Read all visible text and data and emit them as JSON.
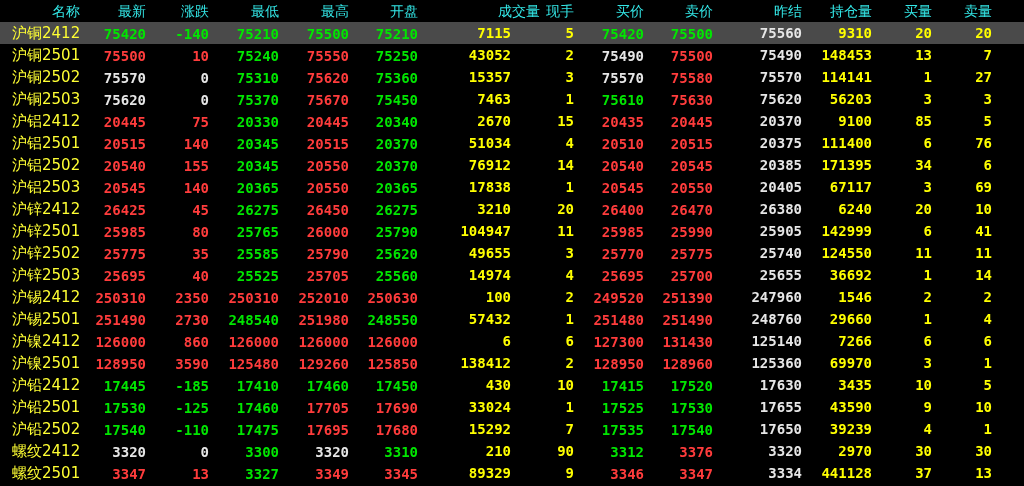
{
  "columns": [
    "名称",
    "最新",
    "涨跌",
    "最低",
    "最高",
    "开盘",
    "成交量",
    "现手",
    "买价",
    "卖价",
    "昨结",
    "持仓量",
    "买量",
    "卖量"
  ],
  "rows": [
    {
      "name": "沪铜2412",
      "selected": true,
      "last": {
        "value": "75420",
        "color": "#00e600"
      },
      "change": {
        "value": "-140",
        "color": "#00e600"
      },
      "low": {
        "value": "75210",
        "color": "#00e600"
      },
      "high": {
        "value": "75500",
        "color": "#00e600"
      },
      "open": {
        "value": "75210",
        "color": "#00e600"
      },
      "volume": "7115",
      "current": "5",
      "bid": {
        "value": "75420",
        "color": "#00e600"
      },
      "ask": {
        "value": "75500",
        "color": "#00e600"
      },
      "prev_settle": "75560",
      "open_interest": "9310",
      "bid_qty": "20",
      "ask_qty": "20"
    },
    {
      "name": "沪铜2501",
      "selected": false,
      "last": {
        "value": "75500",
        "color": "#ff3c3c"
      },
      "change": {
        "value": "10",
        "color": "#ff3c3c"
      },
      "low": {
        "value": "75240",
        "color": "#00e600"
      },
      "high": {
        "value": "75550",
        "color": "#ff3c3c"
      },
      "open": {
        "value": "75250",
        "color": "#00e600"
      },
      "volume": "43052",
      "current": "2",
      "bid": {
        "value": "75490",
        "color": "#e6e6e6"
      },
      "ask": {
        "value": "75500",
        "color": "#ff3c3c"
      },
      "prev_settle": "75490",
      "open_interest": "148453",
      "bid_qty": "13",
      "ask_qty": "7"
    },
    {
      "name": "沪铜2502",
      "selected": false,
      "last": {
        "value": "75570",
        "color": "#e6e6e6"
      },
      "change": {
        "value": "0",
        "color": "#e6e6e6"
      },
      "low": {
        "value": "75310",
        "color": "#00e600"
      },
      "high": {
        "value": "75620",
        "color": "#ff3c3c"
      },
      "open": {
        "value": "75360",
        "color": "#00e600"
      },
      "volume": "15357",
      "current": "3",
      "bid": {
        "value": "75570",
        "color": "#e6e6e6"
      },
      "ask": {
        "value": "75580",
        "color": "#ff3c3c"
      },
      "prev_settle": "75570",
      "open_interest": "114141",
      "bid_qty": "1",
      "ask_qty": "27"
    },
    {
      "name": "沪铜2503",
      "selected": false,
      "last": {
        "value": "75620",
        "color": "#e6e6e6"
      },
      "change": {
        "value": "0",
        "color": "#e6e6e6"
      },
      "low": {
        "value": "75370",
        "color": "#00e600"
      },
      "high": {
        "value": "75670",
        "color": "#ff3c3c"
      },
      "open": {
        "value": "75450",
        "color": "#00e600"
      },
      "volume": "7463",
      "current": "1",
      "bid": {
        "value": "75610",
        "color": "#00e600"
      },
      "ask": {
        "value": "75630",
        "color": "#ff3c3c"
      },
      "prev_settle": "75620",
      "open_interest": "56203",
      "bid_qty": "3",
      "ask_qty": "3"
    },
    {
      "name": "沪铝2412",
      "selected": false,
      "last": {
        "value": "20445",
        "color": "#ff3c3c"
      },
      "change": {
        "value": "75",
        "color": "#ff3c3c"
      },
      "low": {
        "value": "20330",
        "color": "#00e600"
      },
      "high": {
        "value": "20445",
        "color": "#ff3c3c"
      },
      "open": {
        "value": "20340",
        "color": "#00e600"
      },
      "volume": "2670",
      "current": "15",
      "bid": {
        "value": "20435",
        "color": "#ff3c3c"
      },
      "ask": {
        "value": "20445",
        "color": "#ff3c3c"
      },
      "prev_settle": "20370",
      "open_interest": "9100",
      "bid_qty": "85",
      "ask_qty": "5"
    },
    {
      "name": "沪铝2501",
      "selected": false,
      "last": {
        "value": "20515",
        "color": "#ff3c3c"
      },
      "change": {
        "value": "140",
        "color": "#ff3c3c"
      },
      "low": {
        "value": "20345",
        "color": "#00e600"
      },
      "high": {
        "value": "20515",
        "color": "#ff3c3c"
      },
      "open": {
        "value": "20370",
        "color": "#00e600"
      },
      "volume": "51034",
      "current": "4",
      "bid": {
        "value": "20510",
        "color": "#ff3c3c"
      },
      "ask": {
        "value": "20515",
        "color": "#ff3c3c"
      },
      "prev_settle": "20375",
      "open_interest": "111400",
      "bid_qty": "6",
      "ask_qty": "76"
    },
    {
      "name": "沪铝2502",
      "selected": false,
      "last": {
        "value": "20540",
        "color": "#ff3c3c"
      },
      "change": {
        "value": "155",
        "color": "#ff3c3c"
      },
      "low": {
        "value": "20345",
        "color": "#00e600"
      },
      "high": {
        "value": "20550",
        "color": "#ff3c3c"
      },
      "open": {
        "value": "20370",
        "color": "#00e600"
      },
      "volume": "76912",
      "current": "14",
      "bid": {
        "value": "20540",
        "color": "#ff3c3c"
      },
      "ask": {
        "value": "20545",
        "color": "#ff3c3c"
      },
      "prev_settle": "20385",
      "open_interest": "171395",
      "bid_qty": "34",
      "ask_qty": "6"
    },
    {
      "name": "沪铝2503",
      "selected": false,
      "last": {
        "value": "20545",
        "color": "#ff3c3c"
      },
      "change": {
        "value": "140",
        "color": "#ff3c3c"
      },
      "low": {
        "value": "20365",
        "color": "#00e600"
      },
      "high": {
        "value": "20550",
        "color": "#ff3c3c"
      },
      "open": {
        "value": "20365",
        "color": "#00e600"
      },
      "volume": "17838",
      "current": "1",
      "bid": {
        "value": "20545",
        "color": "#ff3c3c"
      },
      "ask": {
        "value": "20550",
        "color": "#ff3c3c"
      },
      "prev_settle": "20405",
      "open_interest": "67117",
      "bid_qty": "3",
      "ask_qty": "69"
    },
    {
      "name": "沪锌2412",
      "selected": false,
      "last": {
        "value": "26425",
        "color": "#ff3c3c"
      },
      "change": {
        "value": "45",
        "color": "#ff3c3c"
      },
      "low": {
        "value": "26275",
        "color": "#00e600"
      },
      "high": {
        "value": "26450",
        "color": "#ff3c3c"
      },
      "open": {
        "value": "26275",
        "color": "#00e600"
      },
      "volume": "3210",
      "current": "20",
      "bid": {
        "value": "26400",
        "color": "#ff3c3c"
      },
      "ask": {
        "value": "26470",
        "color": "#ff3c3c"
      },
      "prev_settle": "26380",
      "open_interest": "6240",
      "bid_qty": "20",
      "ask_qty": "10"
    },
    {
      "name": "沪锌2501",
      "selected": false,
      "last": {
        "value": "25985",
        "color": "#ff3c3c"
      },
      "change": {
        "value": "80",
        "color": "#ff3c3c"
      },
      "low": {
        "value": "25765",
        "color": "#00e600"
      },
      "high": {
        "value": "26000",
        "color": "#ff3c3c"
      },
      "open": {
        "value": "25790",
        "color": "#00e600"
      },
      "volume": "104947",
      "current": "11",
      "bid": {
        "value": "25985",
        "color": "#ff3c3c"
      },
      "ask": {
        "value": "25990",
        "color": "#ff3c3c"
      },
      "prev_settle": "25905",
      "open_interest": "142999",
      "bid_qty": "6",
      "ask_qty": "41"
    },
    {
      "name": "沪锌2502",
      "selected": false,
      "last": {
        "value": "25775",
        "color": "#ff3c3c"
      },
      "change": {
        "value": "35",
        "color": "#ff3c3c"
      },
      "low": {
        "value": "25585",
        "color": "#00e600"
      },
      "high": {
        "value": "25790",
        "color": "#ff3c3c"
      },
      "open": {
        "value": "25620",
        "color": "#00e600"
      },
      "volume": "49655",
      "current": "3",
      "bid": {
        "value": "25770",
        "color": "#ff3c3c"
      },
      "ask": {
        "value": "25775",
        "color": "#ff3c3c"
      },
      "prev_settle": "25740",
      "open_interest": "124550",
      "bid_qty": "11",
      "ask_qty": "11"
    },
    {
      "name": "沪锌2503",
      "selected": false,
      "last": {
        "value": "25695",
        "color": "#ff3c3c"
      },
      "change": {
        "value": "40",
        "color": "#ff3c3c"
      },
      "low": {
        "value": "25525",
        "color": "#00e600"
      },
      "high": {
        "value": "25705",
        "color": "#ff3c3c"
      },
      "open": {
        "value": "25560",
        "color": "#00e600"
      },
      "volume": "14974",
      "current": "4",
      "bid": {
        "value": "25695",
        "color": "#ff3c3c"
      },
      "ask": {
        "value": "25700",
        "color": "#ff3c3c"
      },
      "prev_settle": "25655",
      "open_interest": "36692",
      "bid_qty": "1",
      "ask_qty": "14"
    },
    {
      "name": "沪锡2412",
      "selected": false,
      "last": {
        "value": "250310",
        "color": "#ff3c3c"
      },
      "change": {
        "value": "2350",
        "color": "#ff3c3c"
      },
      "low": {
        "value": "250310",
        "color": "#ff3c3c"
      },
      "high": {
        "value": "252010",
        "color": "#ff3c3c"
      },
      "open": {
        "value": "250630",
        "color": "#ff3c3c"
      },
      "volume": "100",
      "current": "2",
      "bid": {
        "value": "249520",
        "color": "#ff3c3c"
      },
      "ask": {
        "value": "251390",
        "color": "#ff3c3c"
      },
      "prev_settle": "247960",
      "open_interest": "1546",
      "bid_qty": "2",
      "ask_qty": "2"
    },
    {
      "name": "沪锡2501",
      "selected": false,
      "last": {
        "value": "251490",
        "color": "#ff3c3c"
      },
      "change": {
        "value": "2730",
        "color": "#ff3c3c"
      },
      "low": {
        "value": "248540",
        "color": "#00e600"
      },
      "high": {
        "value": "251980",
        "color": "#ff3c3c"
      },
      "open": {
        "value": "248550",
        "color": "#00e600"
      },
      "volume": "57432",
      "current": "1",
      "bid": {
        "value": "251480",
        "color": "#ff3c3c"
      },
      "ask": {
        "value": "251490",
        "color": "#ff3c3c"
      },
      "prev_settle": "248760",
      "open_interest": "29660",
      "bid_qty": "1",
      "ask_qty": "4"
    },
    {
      "name": "沪镍2412",
      "selected": false,
      "last": {
        "value": "126000",
        "color": "#ff3c3c"
      },
      "change": {
        "value": "860",
        "color": "#ff3c3c"
      },
      "low": {
        "value": "126000",
        "color": "#ff3c3c"
      },
      "high": {
        "value": "126000",
        "color": "#ff3c3c"
      },
      "open": {
        "value": "126000",
        "color": "#ff3c3c"
      },
      "volume": "6",
      "current": "6",
      "bid": {
        "value": "127300",
        "color": "#ff3c3c"
      },
      "ask": {
        "value": "131430",
        "color": "#ff3c3c"
      },
      "prev_settle": "125140",
      "open_interest": "7266",
      "bid_qty": "6",
      "ask_qty": "6"
    },
    {
      "name": "沪镍2501",
      "selected": false,
      "last": {
        "value": "128950",
        "color": "#ff3c3c"
      },
      "change": {
        "value": "3590",
        "color": "#ff3c3c"
      },
      "low": {
        "value": "125480",
        "color": "#ff3c3c"
      },
      "high": {
        "value": "129260",
        "color": "#ff3c3c"
      },
      "open": {
        "value": "125850",
        "color": "#ff3c3c"
      },
      "volume": "138412",
      "current": "2",
      "bid": {
        "value": "128950",
        "color": "#ff3c3c"
      },
      "ask": {
        "value": "128960",
        "color": "#ff3c3c"
      },
      "prev_settle": "125360",
      "open_interest": "69970",
      "bid_qty": "3",
      "ask_qty": "1"
    },
    {
      "name": "沪铅2412",
      "selected": false,
      "last": {
        "value": "17445",
        "color": "#00e600"
      },
      "change": {
        "value": "-185",
        "color": "#00e600"
      },
      "low": {
        "value": "17410",
        "color": "#00e600"
      },
      "high": {
        "value": "17460",
        "color": "#00e600"
      },
      "open": {
        "value": "17450",
        "color": "#00e600"
      },
      "volume": "430",
      "current": "10",
      "bid": {
        "value": "17415",
        "color": "#00e600"
      },
      "ask": {
        "value": "17520",
        "color": "#00e600"
      },
      "prev_settle": "17630",
      "open_interest": "3435",
      "bid_qty": "10",
      "ask_qty": "5"
    },
    {
      "name": "沪铅2501",
      "selected": false,
      "last": {
        "value": "17530",
        "color": "#00e600"
      },
      "change": {
        "value": "-125",
        "color": "#00e600"
      },
      "low": {
        "value": "17460",
        "color": "#00e600"
      },
      "high": {
        "value": "17705",
        "color": "#ff3c3c"
      },
      "open": {
        "value": "17690",
        "color": "#ff3c3c"
      },
      "volume": "33024",
      "current": "1",
      "bid": {
        "value": "17525",
        "color": "#00e600"
      },
      "ask": {
        "value": "17530",
        "color": "#00e600"
      },
      "prev_settle": "17655",
      "open_interest": "43590",
      "bid_qty": "9",
      "ask_qty": "10"
    },
    {
      "name": "沪铅2502",
      "selected": false,
      "last": {
        "value": "17540",
        "color": "#00e600"
      },
      "change": {
        "value": "-110",
        "color": "#00e600"
      },
      "low": {
        "value": "17475",
        "color": "#00e600"
      },
      "high": {
        "value": "17695",
        "color": "#ff3c3c"
      },
      "open": {
        "value": "17680",
        "color": "#ff3c3c"
      },
      "volume": "15292",
      "current": "7",
      "bid": {
        "value": "17535",
        "color": "#00e600"
      },
      "ask": {
        "value": "17540",
        "color": "#00e600"
      },
      "prev_settle": "17650",
      "open_interest": "39239",
      "bid_qty": "4",
      "ask_qty": "1"
    },
    {
      "name": "螺纹2412",
      "selected": false,
      "last": {
        "value": "3320",
        "color": "#e6e6e6"
      },
      "change": {
        "value": "0",
        "color": "#e6e6e6"
      },
      "low": {
        "value": "3300",
        "color": "#00e600"
      },
      "high": {
        "value": "3320",
        "color": "#e6e6e6"
      },
      "open": {
        "value": "3310",
        "color": "#00e600"
      },
      "volume": "210",
      "current": "90",
      "bid": {
        "value": "3312",
        "color": "#00e600"
      },
      "ask": {
        "value": "3376",
        "color": "#ff3c3c"
      },
      "prev_settle": "3320",
      "open_interest": "2970",
      "bid_qty": "30",
      "ask_qty": "30"
    },
    {
      "name": "螺纹2501",
      "selected": false,
      "last": {
        "value": "3347",
        "color": "#ff3c3c"
      },
      "change": {
        "value": "13",
        "color": "#ff3c3c"
      },
      "low": {
        "value": "3327",
        "color": "#00e600"
      },
      "high": {
        "value": "3349",
        "color": "#ff3c3c"
      },
      "open": {
        "value": "3345",
        "color": "#ff3c3c"
      },
      "volume": "89329",
      "current": "9",
      "bid": {
        "value": "3346",
        "color": "#ff3c3c"
      },
      "ask": {
        "value": "3347",
        "color": "#ff3c3c"
      },
      "prev_settle": "3334",
      "open_interest": "441128",
      "bid_qty": "37",
      "ask_qty": "13"
    }
  ]
}
